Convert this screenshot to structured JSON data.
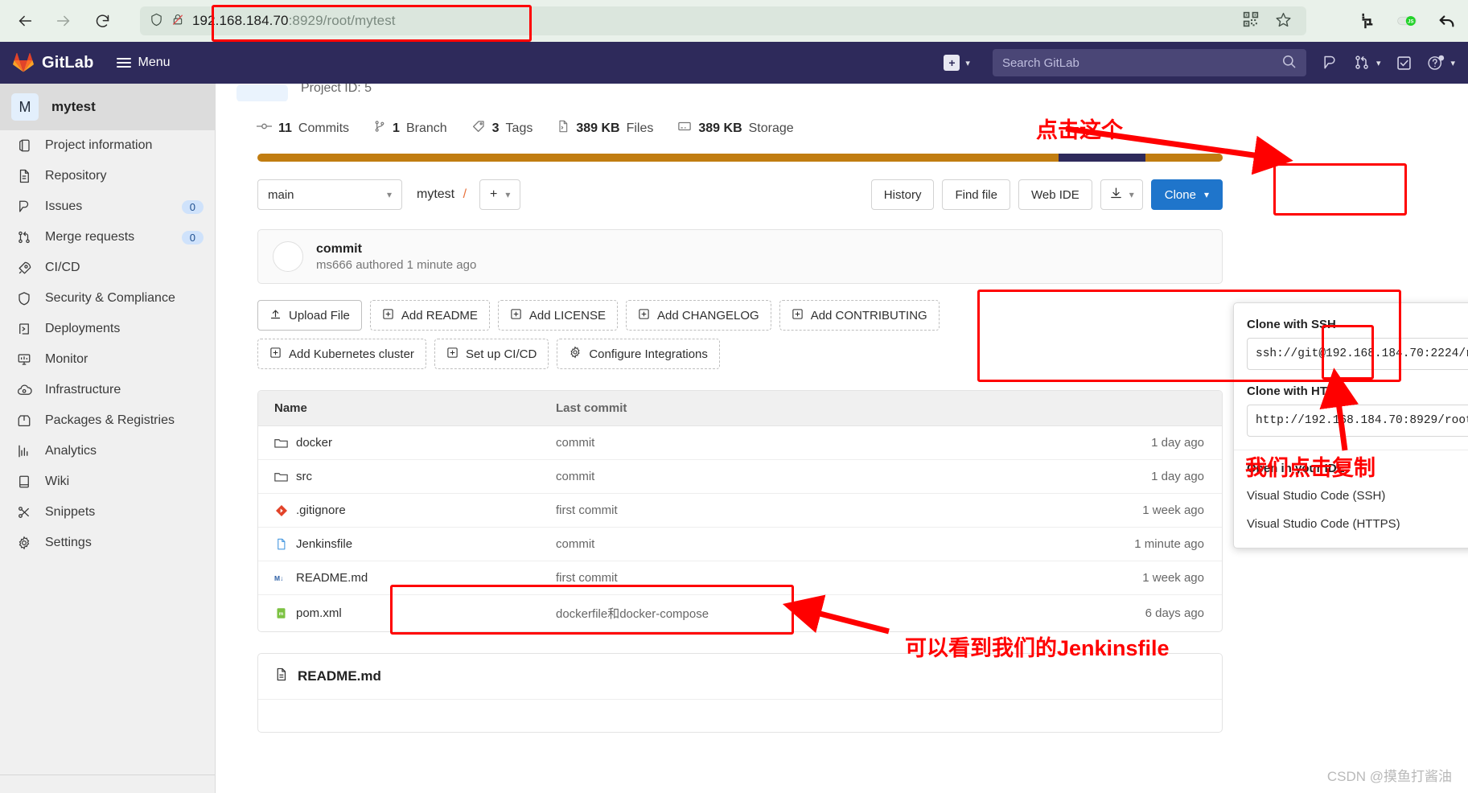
{
  "browser": {
    "back_icon": "back-arrow-icon",
    "forward_icon": "forward-arrow-icon",
    "reload_icon": "reload-icon",
    "shield_icon": "shield-icon",
    "insecure_icon": "insecure-lock-icon",
    "url_host": "192.168.184.70",
    "url_rest": ":8929/root/mytest",
    "qr_icon": "qr-code-icon",
    "bookmark_icon": "star-icon",
    "crop_icon": "crop-icon",
    "js_toggle_icon": "javascript-toggle-icon",
    "undo_icon": "undo-arrow-icon"
  },
  "gitlab_nav": {
    "brand": "GitLab",
    "menu_label": "Menu",
    "create_new_icon": "plus-square-icon",
    "search_placeholder": "Search GitLab",
    "search_icon": "search-icon",
    "issues_icon": "issues-icon",
    "merge_requests_icon": "merge-request-icon",
    "todos_icon": "todo-check-icon",
    "help_icon": "help-question-icon"
  },
  "sidebar": {
    "project_initial": "M",
    "project_name": "mytest",
    "items": [
      {
        "label": "Project information",
        "icon": "project-info-icon",
        "badge": ""
      },
      {
        "label": "Repository",
        "icon": "repository-icon",
        "badge": ""
      },
      {
        "label": "Issues",
        "icon": "issues-icon",
        "badge": "0"
      },
      {
        "label": "Merge requests",
        "icon": "merge-request-icon",
        "badge": "0"
      },
      {
        "label": "CI/CD",
        "icon": "rocket-icon",
        "badge": ""
      },
      {
        "label": "Security & Compliance",
        "icon": "shield-icon",
        "badge": ""
      },
      {
        "label": "Deployments",
        "icon": "deployments-icon",
        "badge": ""
      },
      {
        "label": "Monitor",
        "icon": "monitor-icon",
        "badge": ""
      },
      {
        "label": "Infrastructure",
        "icon": "infrastructure-icon",
        "badge": ""
      },
      {
        "label": "Packages & Registries",
        "icon": "package-icon",
        "badge": ""
      },
      {
        "label": "Analytics",
        "icon": "analytics-icon",
        "badge": ""
      },
      {
        "label": "Wiki",
        "icon": "wiki-book-icon",
        "badge": ""
      },
      {
        "label": "Snippets",
        "icon": "snippet-scissors-icon",
        "badge": ""
      },
      {
        "label": "Settings",
        "icon": "gear-icon",
        "badge": ""
      }
    ]
  },
  "project": {
    "project_id_text": "Project ID: 5",
    "stats": [
      {
        "value": "11",
        "unit": "Commits",
        "icon": "commit-icon"
      },
      {
        "value": "1",
        "unit": "Branch",
        "icon": "branch-icon"
      },
      {
        "value": "3",
        "unit": "Tags",
        "icon": "tag-icon"
      },
      {
        "value": "389 KB",
        "unit": "Files",
        "icon": "file-icon"
      },
      {
        "value": "389 KB",
        "unit": "Storage",
        "icon": "storage-icon"
      }
    ]
  },
  "toolbar": {
    "branch": "main",
    "breadcrumb_project": "mytest",
    "breadcrumb_sep": "/",
    "plus_label": "+",
    "history_label": "History",
    "find_file_label": "Find file",
    "web_ide_label": "Web IDE",
    "download_icon": "download-icon",
    "clone_label": "Clone",
    "clone_caret_icon": "chevron-down-icon"
  },
  "commit_card": {
    "message": "commit",
    "meta": "ms666 authored 1 minute ago",
    "avatar": "user-avatar"
  },
  "quick_actions": {
    "row1": [
      {
        "label": "Upload File",
        "icon": "upload-icon",
        "style": "solid"
      },
      {
        "label": "Add README",
        "icon": "plus-box-icon",
        "style": "dashed"
      },
      {
        "label": "Add LICENSE",
        "icon": "plus-box-icon",
        "style": "dashed"
      },
      {
        "label": "Add CHANGELOG",
        "icon": "plus-box-icon",
        "style": "dashed"
      },
      {
        "label": "Add CONTRIBUTING",
        "icon": "plus-box-icon",
        "style": "dashed"
      }
    ],
    "row2": [
      {
        "label": "Add Kubernetes cluster",
        "icon": "plus-box-icon",
        "style": "dashed"
      },
      {
        "label": "Set up CI/CD",
        "icon": "plus-box-icon",
        "style": "dashed"
      },
      {
        "label": "Configure Integrations",
        "icon": "gear-icon",
        "style": "dashed"
      }
    ]
  },
  "file_table": {
    "headers": {
      "name": "Name",
      "last_commit": "Last commit",
      "updated": ""
    },
    "rows": [
      {
        "name": "docker",
        "icon": "folder-icon",
        "commit": "commit",
        "time": "1 day ago"
      },
      {
        "name": "src",
        "icon": "folder-icon",
        "commit": "commit",
        "time": "1 day ago"
      },
      {
        "name": ".gitignore",
        "icon": "git-icon",
        "commit": "first commit",
        "time": "1 week ago"
      },
      {
        "name": "Jenkinsfile",
        "icon": "file-blue-icon",
        "commit": "commit",
        "time": "1 minute ago"
      },
      {
        "name": "README.md",
        "icon": "markdown-icon",
        "commit": "first commit",
        "time": "1 week ago"
      },
      {
        "name": "pom.xml",
        "icon": "xml-file-icon",
        "commit": "dockerfile和docker-compose",
        "time": "6 days ago"
      }
    ]
  },
  "readme": {
    "title": "README.md",
    "icon": "readme-file-icon"
  },
  "clone_dropdown": {
    "ssh_label": "Clone with SSH",
    "ssh_url": "ssh://git@192.168.184.70:2224/r",
    "http_label": "Clone with HTTP",
    "http_url": "http://192.168.184.70:8929/root",
    "copy_icon": "clipboard-copy-icon",
    "ide_label": "Open in your IDE",
    "ide_items": [
      "Visual Studio Code (SSH)",
      "Visual Studio Code (HTTPS)"
    ]
  },
  "annotations": {
    "click_this": "点击这个",
    "click_copy": "我们点击复制",
    "see_jenkinsfile": "可以看到我们的Jenkinsfile",
    "accent_red": "#ff0000"
  },
  "watermark": "CSDN @摸鱼打酱油"
}
